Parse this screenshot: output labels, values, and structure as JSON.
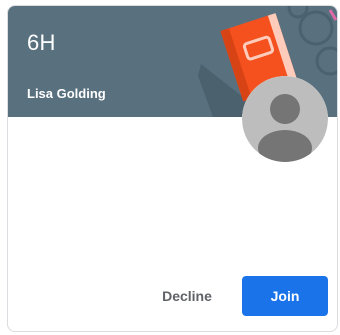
{
  "card": {
    "class_name": "6H",
    "teacher": "Lisa Golding",
    "header_color": "#59717f",
    "illustration_icon": "book-illustration-icon",
    "avatar_icon": "default-profile-icon"
  },
  "actions": {
    "decline_label": "Decline",
    "join_label": "Join",
    "join_color": "#1a73e8"
  }
}
